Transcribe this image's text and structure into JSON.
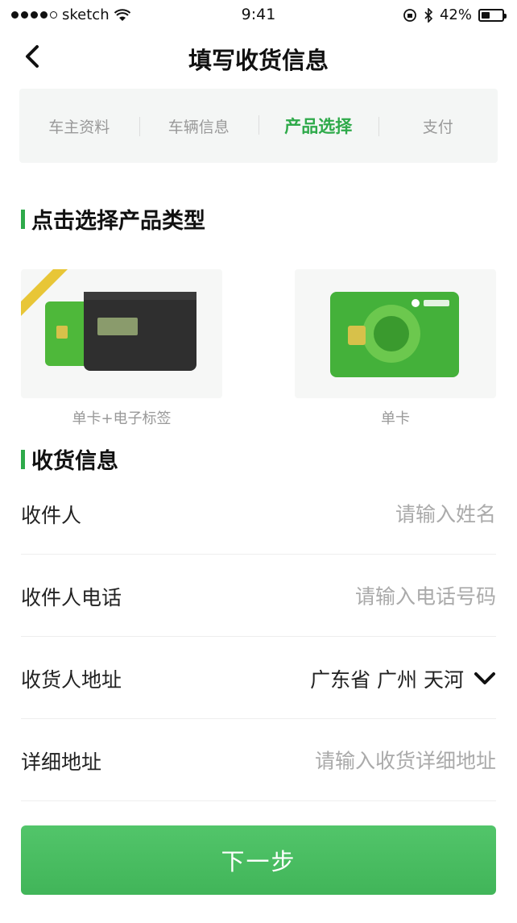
{
  "status_bar": {
    "carrier": "sketch",
    "time": "9:41",
    "battery": "42%",
    "battery_level": 0.42
  },
  "nav": {
    "title": "填写收货信息",
    "back_icon": "chevron-left-icon"
  },
  "steps": [
    {
      "label": "车主资料",
      "active": false
    },
    {
      "label": "车辆信息",
      "active": false
    },
    {
      "label": "产品选择",
      "active": true
    },
    {
      "label": "支付",
      "active": false
    }
  ],
  "product_section": {
    "title": "点击选择产品类型",
    "products": [
      {
        "label": "单卡+电子标签"
      },
      {
        "label": "单卡"
      }
    ]
  },
  "shipping_section": {
    "title": "收货信息",
    "fields": [
      {
        "label": "收件人",
        "placeholder": "请输入姓名",
        "value": ""
      },
      {
        "label": "收件人电话",
        "placeholder": "请输入电话号码",
        "value": ""
      },
      {
        "label": "收货人地址",
        "value": "广东省 广州 天河"
      },
      {
        "label": "详细地址",
        "placeholder": "请输入收货详细地址",
        "value": ""
      }
    ]
  },
  "next_button": {
    "label": "下一步"
  },
  "colors": {
    "accent": "#2eaa4a",
    "button": "#4abd61"
  }
}
